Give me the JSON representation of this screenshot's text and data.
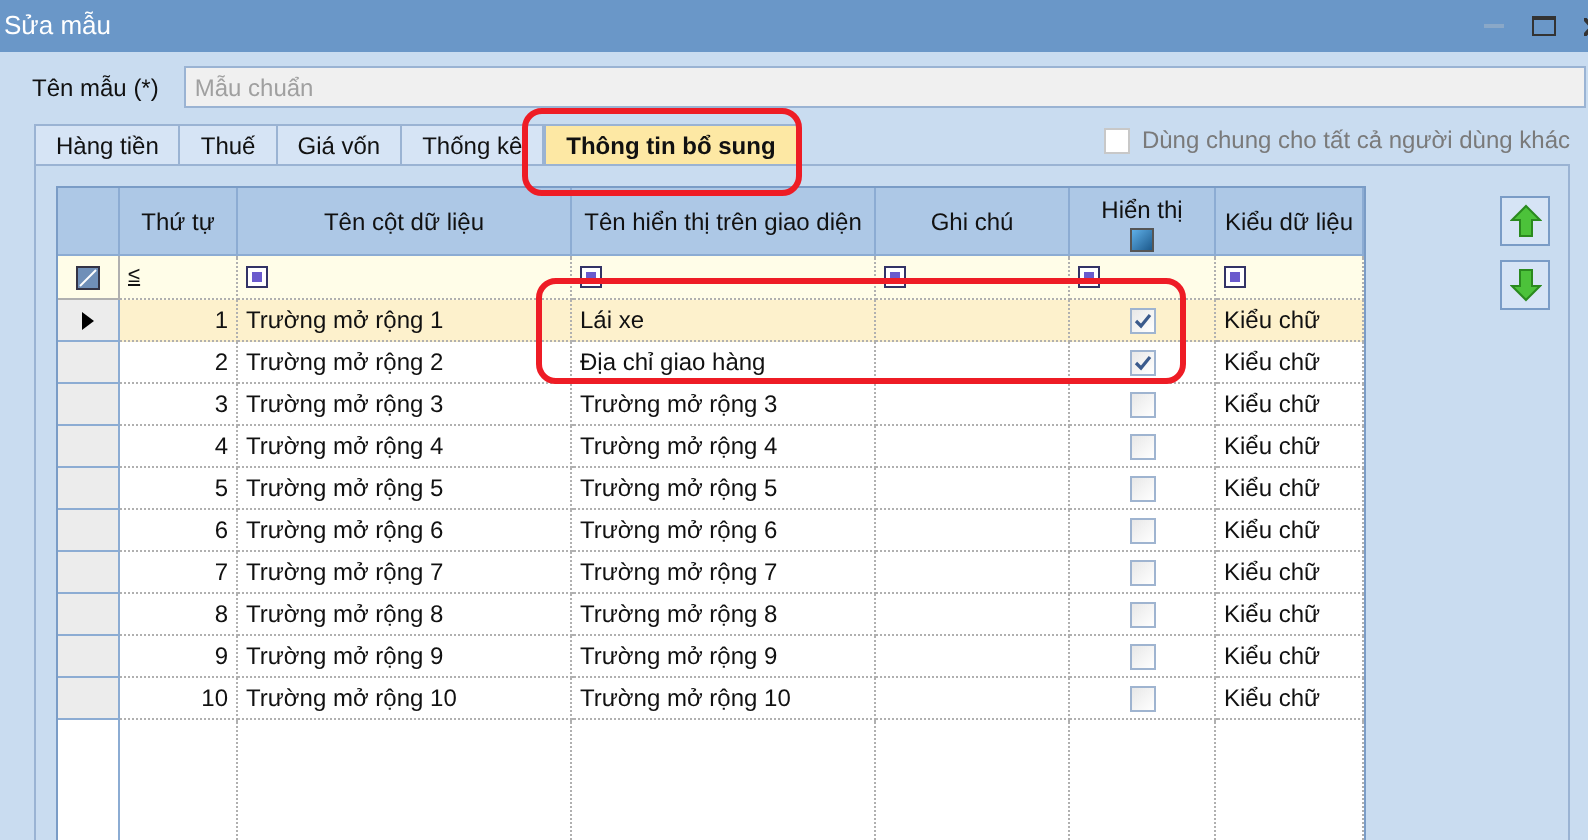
{
  "window": {
    "title": "Sửa mẫu"
  },
  "template_name": {
    "label": "Tên mẫu (*)",
    "placeholder": "Mẫu chuẩn"
  },
  "tabs": [
    {
      "label": "Hàng tiền",
      "selected": false
    },
    {
      "label": "Thuế",
      "selected": false
    },
    {
      "label": "Giá vốn",
      "selected": false
    },
    {
      "label": "Thống kê",
      "selected": false
    },
    {
      "label": "Thông tin bổ sung",
      "selected": true
    }
  ],
  "share_option": {
    "label": "Dùng chung cho tất cả người dùng khác",
    "checked": false,
    "disabled": true
  },
  "table": {
    "columns": [
      "Thứ tự",
      "Tên cột dữ liệu",
      "Tên hiển thị trên giao diện",
      "Ghi chú",
      "Hiển thị",
      "Kiểu dữ liệu"
    ],
    "filter_operator": "≤",
    "rows": [
      {
        "order": "1",
        "field": "Trường mở rộng 1",
        "display_name": "Lái xe",
        "visible": true,
        "type": "Kiểu chữ",
        "selected": true
      },
      {
        "order": "2",
        "field": "Trường mở rộng 2",
        "display_name": "Địa chỉ giao hàng",
        "visible": true,
        "type": "Kiểu chữ",
        "selected": false
      },
      {
        "order": "3",
        "field": "Trường mở rộng 3",
        "display_name": "Trường mở rộng 3",
        "visible": false,
        "type": "Kiểu chữ",
        "selected": false
      },
      {
        "order": "4",
        "field": "Trường mở rộng 4",
        "display_name": "Trường mở rộng 4",
        "visible": false,
        "type": "Kiểu chữ",
        "selected": false
      },
      {
        "order": "5",
        "field": "Trường mở rộng 5",
        "display_name": "Trường mở rộng 5",
        "visible": false,
        "type": "Kiểu chữ",
        "selected": false
      },
      {
        "order": "6",
        "field": "Trường mở rộng 6",
        "display_name": "Trường mở rộng 6",
        "visible": false,
        "type": "Kiểu chữ",
        "selected": false
      },
      {
        "order": "7",
        "field": "Trường mở rộng 7",
        "display_name": "Trường mở rộng 7",
        "visible": false,
        "type": "Kiểu chữ",
        "selected": false
      },
      {
        "order": "8",
        "field": "Trường mở rộng 8",
        "display_name": "Trường mở rộng 8",
        "visible": false,
        "type": "Kiểu chữ",
        "selected": false
      },
      {
        "order": "9",
        "field": "Trường mở rộng 9",
        "display_name": "Trường mở rộng 9",
        "visible": false,
        "type": "Kiểu chữ",
        "selected": false
      },
      {
        "order": "10",
        "field": "Trường mở rộng 10",
        "display_name": "Trường mở rộng 10",
        "visible": false,
        "type": "Kiểu chữ",
        "selected": false
      }
    ]
  }
}
